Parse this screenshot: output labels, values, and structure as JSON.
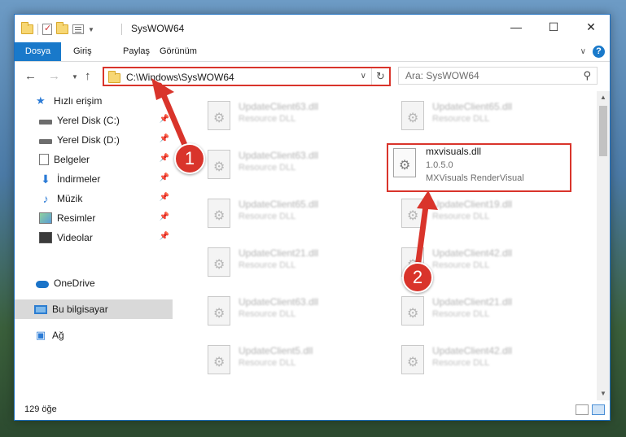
{
  "window": {
    "title": "SysWOW64",
    "controls": {
      "minimize": "—",
      "maximize": "☐",
      "close": "✕"
    }
  },
  "ribbon": {
    "tabs": [
      "Dosya",
      "Giriş",
      "Paylaş",
      "Görünüm"
    ],
    "help": "?"
  },
  "address": {
    "path": "C:\\Windows\\SysWOW64",
    "search_placeholder": "Ara: SysWOW64"
  },
  "sidebar": {
    "items": [
      {
        "label": "Hızlı erişim",
        "icon": "star-icon"
      },
      {
        "label": "Yerel Disk (C:)",
        "icon": "disk-icon",
        "pinned": true
      },
      {
        "label": "Yerel Disk (D:)",
        "icon": "disk-icon",
        "pinned": true
      },
      {
        "label": "Belgeler",
        "icon": "documents-icon",
        "pinned": true
      },
      {
        "label": "İndirmeler",
        "icon": "download-icon",
        "pinned": true
      },
      {
        "label": "Müzik",
        "icon": "music-icon",
        "pinned": true
      },
      {
        "label": "Resimler",
        "icon": "pictures-icon",
        "pinned": true
      },
      {
        "label": "Videolar",
        "icon": "videos-icon",
        "pinned": true
      },
      {
        "label": "OneDrive",
        "icon": "onedrive-icon"
      },
      {
        "label": "Bu bilgisayar",
        "icon": "computer-icon",
        "selected": true
      },
      {
        "label": "Ağ",
        "icon": "network-icon"
      }
    ]
  },
  "files": {
    "left": [
      {
        "name": "UpdateClient63.dll",
        "type": "Resource DLL"
      },
      {
        "name": "UpdateClient63.dll",
        "type": "Resource DLL"
      },
      {
        "name": "UpdateClient65.dll",
        "type": "Resource DLL"
      },
      {
        "name": "UpdateClient21.dll",
        "type": "Resource DLL"
      },
      {
        "name": "UpdateClient63.dll",
        "type": "Resource DLL"
      },
      {
        "name": "UpdateClient5.dll",
        "type": "Resource DLL"
      }
    ],
    "right": [
      {
        "name": "UpdateClient65.dll",
        "type": "Resource DLL"
      },
      {
        "name": "mxvisuals.dll",
        "version": "1.0.5.0",
        "type": "MXVisuals RenderVisual",
        "highlighted": true
      },
      {
        "name": "UpdateClient19.dll",
        "type": "Resource DLL"
      },
      {
        "name": "UpdateClient42.dll",
        "type": "Resource DLL"
      },
      {
        "name": "UpdateClient21.dll",
        "type": "Resource DLL"
      },
      {
        "name": "UpdateClient42.dll",
        "type": "Resource DLL"
      }
    ]
  },
  "status": {
    "item_count": "129 öğe"
  },
  "annotations": {
    "step1": "1",
    "step2": "2",
    "color": "#d9342b"
  }
}
